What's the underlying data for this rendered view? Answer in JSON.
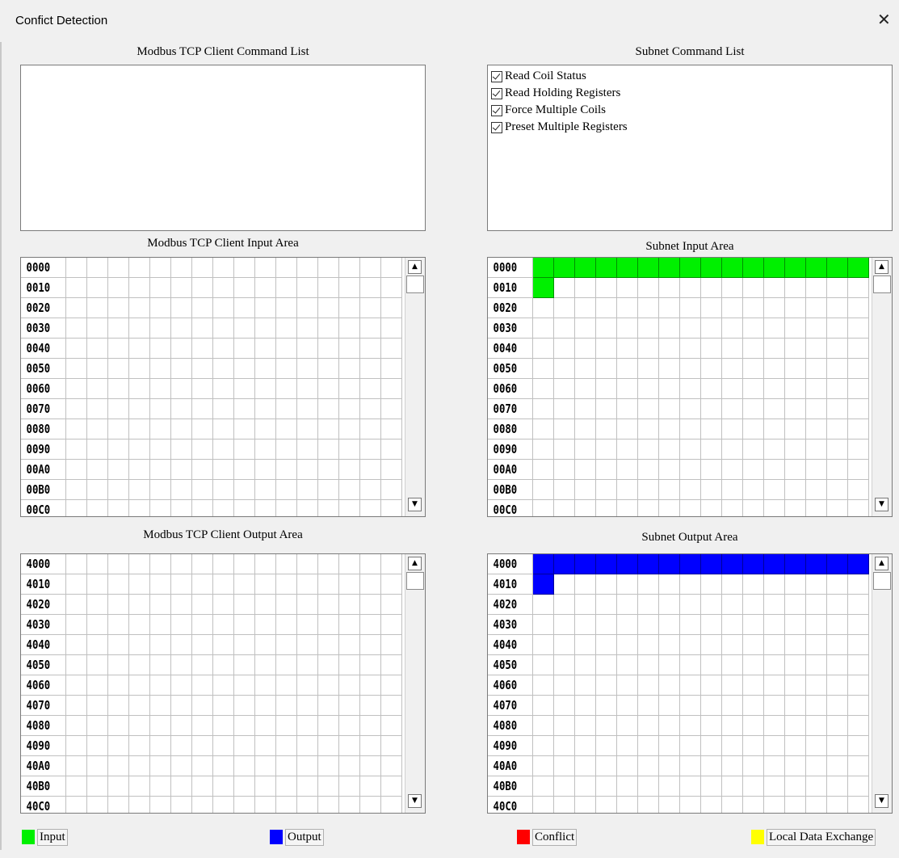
{
  "window": {
    "title": "Confict Detection",
    "close_symbol": "✕"
  },
  "labels": {
    "client_command_list": "Modbus TCP Client Command List",
    "subnet_command_list": "Subnet Command List",
    "client_input_area": "Modbus TCP Client Input Area",
    "subnet_input_area": "Subnet Input Area",
    "client_output_area": "Modbus TCP Client Output Area",
    "subnet_output_area": "Subnet Output Area"
  },
  "subnet_commands": [
    {
      "label": "Read Coil Status",
      "checked": true
    },
    {
      "label": "Read Holding Registers",
      "checked": true
    },
    {
      "label": "Force Multiple Coils",
      "checked": true
    },
    {
      "label": "Preset Multiple Registers",
      "checked": true
    }
  ],
  "input_addresses": [
    "0000",
    "0010",
    "0020",
    "0030",
    "0040",
    "0050",
    "0060",
    "0070",
    "0080",
    "0090",
    "00A0",
    "00B0",
    "00C0"
  ],
  "output_addresses": [
    "4000",
    "4010",
    "4020",
    "4030",
    "4040",
    "4050",
    "4060",
    "4070",
    "4080",
    "4090",
    "40A0",
    "40B0",
    "40C0"
  ],
  "subnet_input_used_cells": 17,
  "subnet_output_used_cells": 17,
  "legend": [
    {
      "label": "Input",
      "color": "#00f000"
    },
    {
      "label": "Output",
      "color": "#0000ff"
    },
    {
      "label": "Conflict",
      "color": "#ff0000"
    },
    {
      "label": "Local Data Exchange",
      "color": "#ffff00"
    }
  ]
}
